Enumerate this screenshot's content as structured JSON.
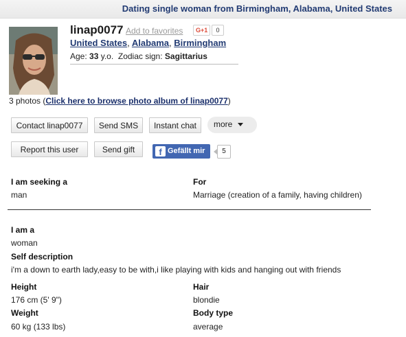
{
  "banner": {
    "title": "Dating single woman from Birmingham, Alabama, United States"
  },
  "profile": {
    "username": "linap0077",
    "add_to_favorites": "Add to favorites",
    "gplus_label": "G+1",
    "gplus_count": "0",
    "location": {
      "country": "United States",
      "state": "Alabama",
      "city": "Birmingham",
      "separator": ","
    },
    "age_label": "Age:",
    "age_value": "33",
    "age_unit": "y.o.",
    "zodiac_label": "Zodiac sign:",
    "zodiac_value": "Sagittarius",
    "photos_count_text": "3 photos (",
    "photos_link": "Click here to browse photo album of linap0077",
    "photos_close": ")"
  },
  "actions": {
    "contact": "Contact linap0077",
    "sms": "Send SMS",
    "chat": "Instant chat",
    "more": "more",
    "report": "Report this user",
    "gift": "Send gift",
    "fb_like": "Gefällt mir",
    "fb_icon": "f",
    "fb_count": "5"
  },
  "details": {
    "seeking_label": "I am seeking a",
    "seeking_value": "man",
    "for_label": "For",
    "for_value": "Marriage (creation of a family, having children)",
    "iam_label": "I am a",
    "iam_value": "woman",
    "self_label": "Self description",
    "self_value": "i'm a down to earth lady,easy to be with,i like playing with kids and hanging out with friends",
    "height_label": "Height",
    "height_value": "176 cm (5' 9\")",
    "hair_label": "Hair",
    "hair_value": "blondie",
    "weight_label": "Weight",
    "weight_value": "60 kg (133 lbs)",
    "body_label": "Body type",
    "body_value": "average"
  },
  "colors": {
    "link": "#223b73",
    "facebook": "#4267b2",
    "gplus": "#dd4b39"
  }
}
